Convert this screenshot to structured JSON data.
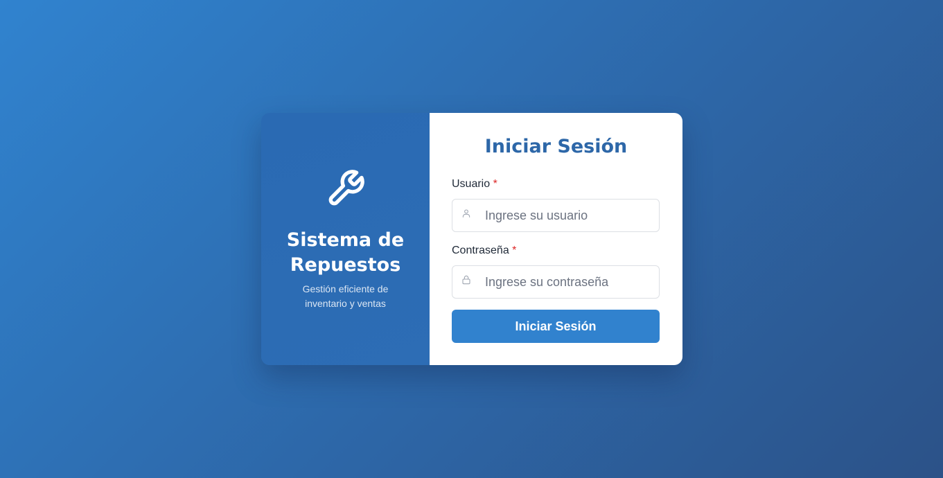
{
  "brand": {
    "icon": "wrench-icon",
    "title_line1": "Sistema de",
    "title_line2": "Repuestos",
    "subtitle_line1": "Gestión eficiente de",
    "subtitle_line2": "inventario y ventas"
  },
  "login": {
    "title": "Iniciar Sesión",
    "username": {
      "label": "Usuario",
      "required_mark": "*",
      "placeholder": "Ingrese su usuario",
      "value": "",
      "icon": "user-icon"
    },
    "password": {
      "label": "Contraseña",
      "required_mark": "*",
      "placeholder": "Ingrese su contraseña",
      "value": "",
      "icon": "lock-icon"
    },
    "submit_label": "Iniciar Sesión"
  },
  "colors": {
    "accent": "#3182ce",
    "brand_panel": "#2a6ab3",
    "title": "#2d67a8",
    "required": "#dc2626"
  }
}
